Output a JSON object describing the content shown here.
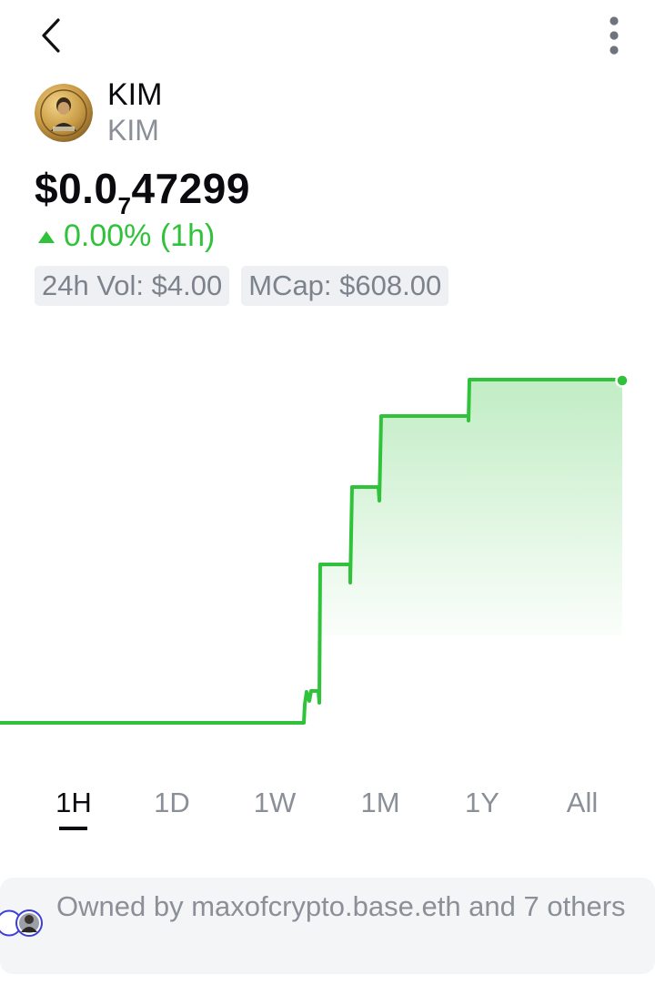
{
  "nav": {
    "back_icon": "chevron-left-icon",
    "more_icon": "more-vertical-icon"
  },
  "token": {
    "name": "KIM",
    "symbol": "KIM",
    "price_prefix": "$0.0",
    "price_subscript": "7",
    "price_digits": "47299",
    "change": "0.00% (1h)",
    "change_direction": "up",
    "volume_label": "24h Vol: $4.00",
    "mcap_label": "MCap: $608.00"
  },
  "colors": {
    "accent_green": "#2fc23a",
    "muted_text": "#8a8f98",
    "pill_bg": "#eef0f3"
  },
  "chart_data": {
    "type": "line",
    "style": "step",
    "series": [
      {
        "values": [
          0,
          0.1,
          0.45,
          0.66,
          0.88,
          0.97,
          1.0,
          1.0
        ]
      }
    ],
    "area_fill": true,
    "grid": false
  },
  "ranges": {
    "tabs": [
      {
        "label": "1H",
        "active": true
      },
      {
        "label": "1D",
        "active": false
      },
      {
        "label": "1W",
        "active": false
      },
      {
        "label": "1M",
        "active": false
      },
      {
        "label": "1Y",
        "active": false
      },
      {
        "label": "All",
        "active": false
      }
    ]
  },
  "owners": {
    "text": "Owned by maxofcrypto.base.eth and 7 others"
  }
}
